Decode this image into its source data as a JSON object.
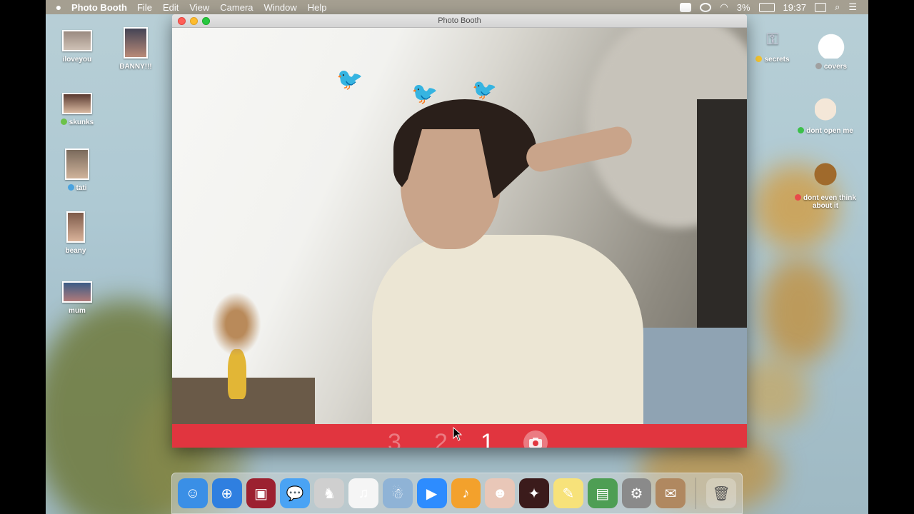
{
  "menubar": {
    "app_name": "Photo Booth",
    "menus": [
      "File",
      "Edit",
      "View",
      "Camera",
      "Window",
      "Help"
    ],
    "battery": "3%",
    "time": "19:37"
  },
  "window": {
    "title": "Photo Booth"
  },
  "countdown": {
    "three": "3",
    "two": "2",
    "one": "1",
    "current": 1
  },
  "desktop_left": [
    {
      "label": "iloveyou",
      "tag_color": ""
    },
    {
      "label": "BANNY!!!",
      "tag_color": ""
    },
    {
      "label": "skunks",
      "tag_color": "#6cc24a"
    },
    {
      "label": "tati",
      "tag_color": "#4aa3df"
    },
    {
      "label": "beany",
      "tag_color": ""
    },
    {
      "label": "mum",
      "tag_color": ""
    }
  ],
  "desktop_right": [
    {
      "label": "secrets",
      "tag_color": "#f4c430"
    },
    {
      "label": "covers",
      "tag_color": "#a0a0a0"
    },
    {
      "label": "dont open me",
      "tag_color": "#3cc04a"
    },
    {
      "label": "dont even think about it",
      "tag_color": "#e84a4a"
    }
  ],
  "dock": {
    "apps": [
      {
        "name": "finder",
        "color": "#3a8fe6",
        "glyph": "☺"
      },
      {
        "name": "safari",
        "color": "#2f7fe0",
        "glyph": "⊕"
      },
      {
        "name": "photo-booth",
        "color": "#9c2130",
        "glyph": "▣"
      },
      {
        "name": "messages",
        "color": "#4aa3f4",
        "glyph": "💬"
      },
      {
        "name": "app-5",
        "color": "#cfcfcf",
        "glyph": "♞"
      },
      {
        "name": "itunes",
        "color": "#f5f5f5",
        "glyph": "♫"
      },
      {
        "name": "app-7",
        "color": "#8fb3d6",
        "glyph": "☃"
      },
      {
        "name": "zoom",
        "color": "#2d8cff",
        "glyph": "▶"
      },
      {
        "name": "garageband",
        "color": "#f3a12c",
        "glyph": "♪"
      },
      {
        "name": "app-10",
        "color": "#e9c7b8",
        "glyph": "☻"
      },
      {
        "name": "app-11",
        "color": "#3b1b1b",
        "glyph": "✦"
      },
      {
        "name": "stickies",
        "color": "#f7e27a",
        "glyph": "✎"
      },
      {
        "name": "preview",
        "color": "#4e9e54",
        "glyph": "▤"
      },
      {
        "name": "system-preferences",
        "color": "#8a8a8a",
        "glyph": "⚙"
      },
      {
        "name": "app-15",
        "color": "#b08860",
        "glyph": "✉"
      }
    ],
    "trash": {
      "name": "trash",
      "glyph": "🗑"
    }
  }
}
